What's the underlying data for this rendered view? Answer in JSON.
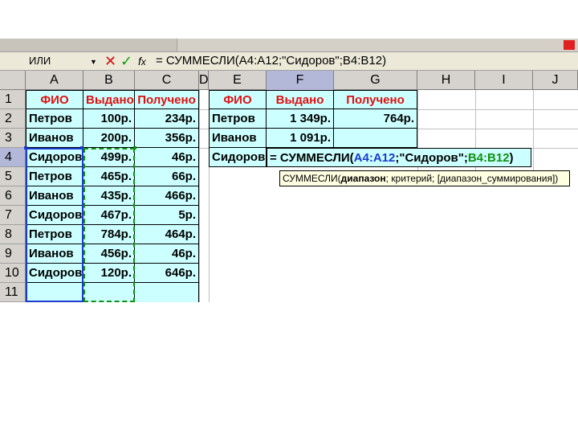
{
  "formula_bar": {
    "name_box": "ИЛИ",
    "formula": "= СУММЕСЛИ(A4:A12;\"Сидоров\";B4:B12)"
  },
  "icons": {
    "cancel": "x-icon",
    "enter": "check-icon",
    "function": "fx-icon",
    "dropdown": "chevron-down-icon"
  },
  "columns": [
    "A",
    "B",
    "C",
    "D",
    "E",
    "F",
    "G",
    "H",
    "I",
    "J"
  ],
  "rows": [
    "1",
    "2",
    "3",
    "4",
    "5",
    "6",
    "7",
    "8",
    "9",
    "10",
    "11"
  ],
  "table1": {
    "headers": [
      "ФИО",
      "Выдано",
      "Получено"
    ],
    "rows": [
      [
        "Петров",
        "100р.",
        "234р."
      ],
      [
        "Иванов",
        "200р.",
        "356р."
      ],
      [
        "Сидоров",
        "499р.",
        "46р."
      ],
      [
        "Петров",
        "465р.",
        "66р."
      ],
      [
        "Иванов",
        "435р.",
        "466р."
      ],
      [
        "Сидоров",
        "467р.",
        "5р."
      ],
      [
        "Петров",
        "784р.",
        "464р."
      ],
      [
        "Иванов",
        "456р.",
        "46р."
      ],
      [
        "Сидоров",
        "120р.",
        "646р."
      ]
    ]
  },
  "table2": {
    "headers": [
      "ФИО",
      "Выдано",
      "Получено"
    ],
    "rows": [
      [
        "Петров",
        "1 349р.",
        "764р."
      ],
      [
        "Иванов",
        "1 091р.",
        ""
      ],
      [
        "Сидоров",
        "",
        ""
      ]
    ]
  },
  "editing": {
    "prefix": "= СУММЕСЛИ(",
    "range1": "A4:A12",
    "sep1": ";\"Сидоров\";",
    "range2": "B4:B12",
    "suffix": ")"
  },
  "tooltip": {
    "fn": "СУММЕСЛИ(",
    "arg1": "диапазон",
    "rest": "; критерий; [диапазон_суммирования])"
  },
  "colors": {
    "header_red": "#e01010",
    "cyan_fill": "#ccffff",
    "ref_blue": "#1a3ad0",
    "ref_green": "#109010"
  }
}
